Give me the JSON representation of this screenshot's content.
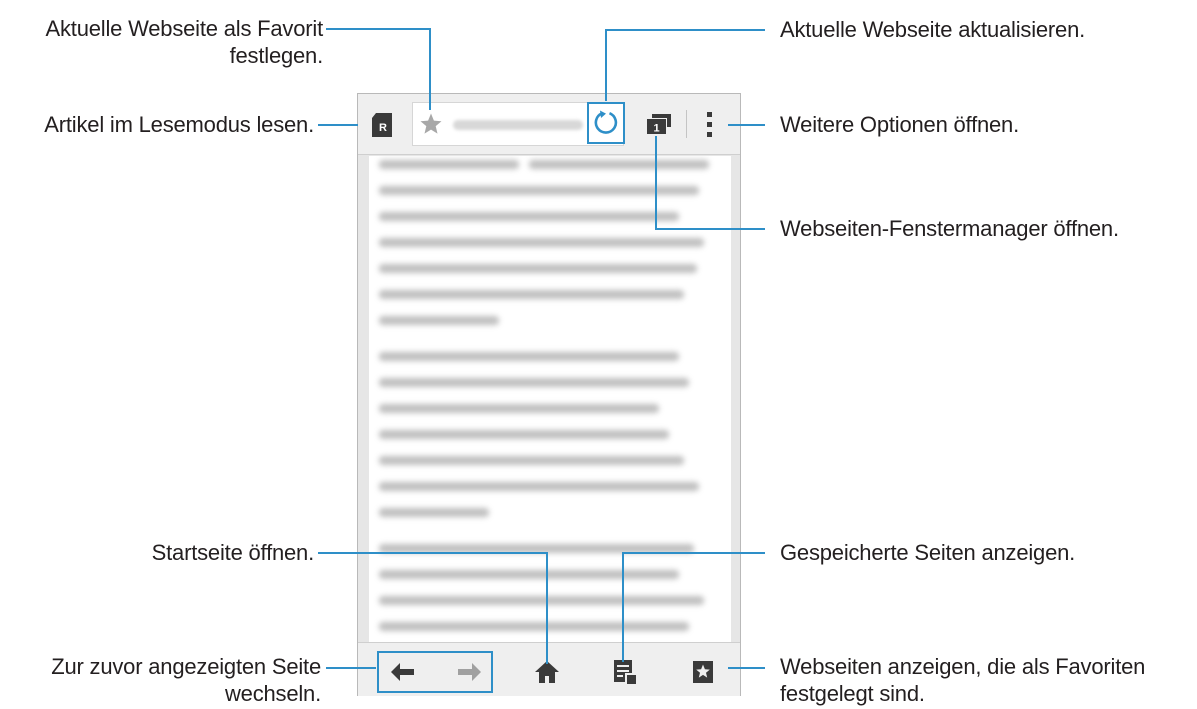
{
  "annotations": {
    "favorite": "Aktuelle Webseite als Favorit festlegen.",
    "favorite_line1": "Aktuelle Webseite als Favorit",
    "favorite_line2": "festlegen.",
    "reader": "Artikel im Lesemodus lesen.",
    "refresh": "Aktuelle Webseite aktualisieren.",
    "more_options": "Weitere Optionen öffnen.",
    "window_manager": "Webseiten-Fenstermanager öffnen.",
    "home": "Startseite öffnen.",
    "saved_pages": "Gespeicherte Seiten anzeigen.",
    "back_forward_line1": "Zur zuvor angezeigten Seite",
    "back_forward_line2": "wechseln.",
    "bookmarks_line1": "Webseiten anzeigen, die als Favoriten",
    "bookmarks_line2": "festgelegt sind."
  },
  "browser": {
    "reader_icon_letter": "R",
    "window_count": "1",
    "icons": [
      "reader-icon",
      "star-icon",
      "refresh-icon",
      "window-manager-icon",
      "more-options-icon",
      "back-icon",
      "forward-icon",
      "home-icon",
      "saved-pages-icon",
      "bookmarks-icon"
    ]
  },
  "colors": {
    "leader": "#2e8fc8",
    "icon": "#3a3a3a",
    "icon_disabled": "#9a9a9a"
  }
}
